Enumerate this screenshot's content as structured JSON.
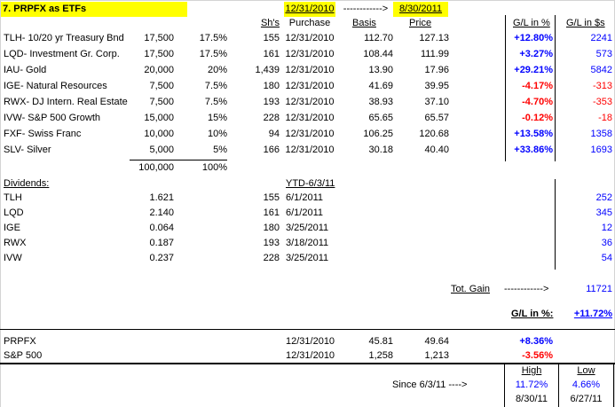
{
  "title": "7. PRPFX as ETFs",
  "header": {
    "start_date": "12/31/2010",
    "arrow": "------------>",
    "end_date": "8/30/2011",
    "shares": "Sh's",
    "purchase": "Purchase",
    "basis": "Basis",
    "price": "Price",
    "gl_pct": "G/L in %",
    "gl_usd": "G/L in $s"
  },
  "holdings": [
    {
      "name": "TLH- 10/20 yr Treasury Bnd",
      "amount": "17,500",
      "alloc": "17.5%",
      "shares": "155",
      "purchase": "12/31/2010",
      "basis": "112.70",
      "price": "127.13",
      "gl_pct": "+12.80%",
      "gl_usd": "2241"
    },
    {
      "name": "LQD- Investment Gr. Corp.",
      "amount": "17,500",
      "alloc": "17.5%",
      "shares": "161",
      "purchase": "12/31/2010",
      "basis": "108.44",
      "price": "111.99",
      "gl_pct": "+3.27%",
      "gl_usd": "573"
    },
    {
      "name": "IAU- Gold",
      "amount": "20,000",
      "alloc": "20%",
      "shares": "1,439",
      "purchase": "12/31/2010",
      "basis": "13.90",
      "price": "17.96",
      "gl_pct": "+29.21%",
      "gl_usd": "5842"
    },
    {
      "name": "IGE- Natural Resources",
      "amount": "7,500",
      "alloc": "7.5%",
      "shares": "180",
      "purchase": "12/31/2010",
      "basis": "41.69",
      "price": "39.95",
      "gl_pct": "-4.17%",
      "gl_usd": "-313"
    },
    {
      "name": "RWX- DJ Intern. Real Estate",
      "amount": "7,500",
      "alloc": "7.5%",
      "shares": "193",
      "purchase": "12/31/2010",
      "basis": "38.93",
      "price": "37.10",
      "gl_pct": "-4.70%",
      "gl_usd": "-353"
    },
    {
      "name": "IVW- S&P 500 Growth",
      "amount": "15,000",
      "alloc": "15%",
      "shares": "228",
      "purchase": "12/31/2010",
      "basis": "65.65",
      "price": "65.57",
      "gl_pct": "-0.12%",
      "gl_usd": "-18"
    },
    {
      "name": "FXF- Swiss Franc",
      "amount": "10,000",
      "alloc": "10%",
      "shares": "94",
      "purchase": "12/31/2010",
      "basis": "106.25",
      "price": "120.68",
      "gl_pct": "+13.58%",
      "gl_usd": "1358"
    },
    {
      "name": "SLV- Silver",
      "amount": "5,000",
      "alloc": "5%",
      "shares": "166",
      "purchase": "12/31/2010",
      "basis": "30.18",
      "price": "40.40",
      "gl_pct": "+33.86%",
      "gl_usd": "1693"
    }
  ],
  "totals": {
    "amount": "100,000",
    "alloc": "100%"
  },
  "dividends": {
    "label": "Dividends:",
    "ytd": "YTD-6/3/11",
    "rows": [
      {
        "ticker": "TLH",
        "amount": "1.621",
        "shares": "155",
        "date": "6/1/2011",
        "total": "252"
      },
      {
        "ticker": "LQD",
        "amount": "2.140",
        "shares": "161",
        "date": "6/1/2011",
        "total": "345"
      },
      {
        "ticker": "IGE",
        "amount": "0.064",
        "shares": "180",
        "date": "3/25/2011",
        "total": "12"
      },
      {
        "ticker": "RWX",
        "amount": "0.187",
        "shares": "193",
        "date": "3/18/2011",
        "total": "36"
      },
      {
        "ticker": "IVW",
        "amount": "0.237",
        "shares": "228",
        "date": "3/25/2011",
        "total": "54"
      }
    ]
  },
  "summary": {
    "tot_gain_label": "Tot. Gain",
    "tot_gain_arrow": "------------>",
    "tot_gain_value": "11721",
    "gl_label": "G/L in %:",
    "gl_value": "+11.72%"
  },
  "benchmarks": [
    {
      "name": "PRPFX",
      "date": "12/31/2010",
      "basis": "45.81",
      "price": "49.64",
      "gl_pct": "+8.36%"
    },
    {
      "name": "S&P 500",
      "date": "12/31/2010",
      "basis": "1,258",
      "price": "1,213",
      "gl_pct": "-3.56%"
    }
  ],
  "since": {
    "label": "Since 6/3/11 ---->",
    "high_label": "High",
    "low_label": "Low",
    "high_value": "11.72%",
    "low_value": "4.66%",
    "high_date": "8/30/11",
    "low_date": "6/27/11"
  },
  "colors": {
    "highlight": "#ffff00",
    "positive": "#0000ff",
    "negative": "#ff0000"
  }
}
